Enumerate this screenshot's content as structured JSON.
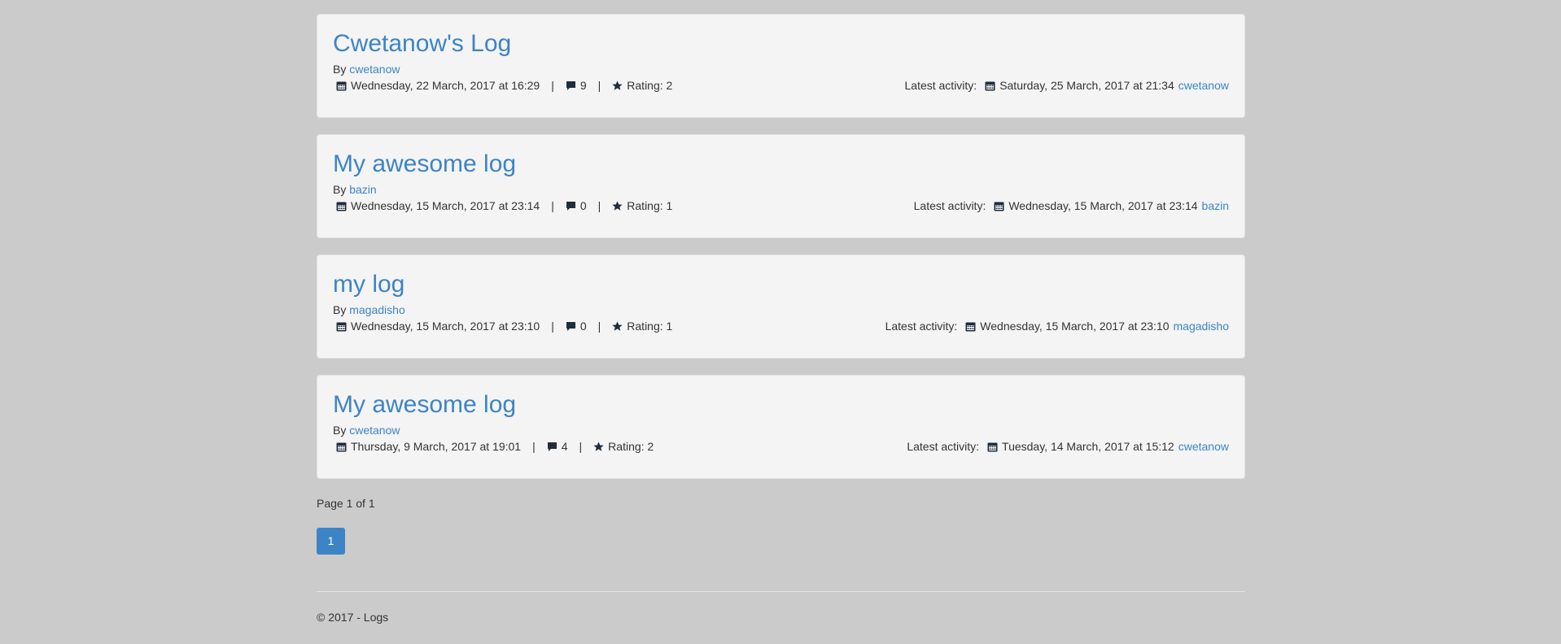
{
  "logs": [
    {
      "title": "Cwetanow's Log",
      "by_label": "By",
      "author": "cwetanow",
      "created": "Wednesday, 22 March, 2017 at 16:29",
      "comments": "9",
      "rating": "Rating: 2",
      "latest_label": "Latest activity:",
      "latest_date": "Saturday, 25 March, 2017 at 21:34",
      "latest_user": "cwetanow"
    },
    {
      "title": "My awesome log",
      "by_label": "By",
      "author": "bazin",
      "created": "Wednesday, 15 March, 2017 at 23:14",
      "comments": "0",
      "rating": "Rating: 1",
      "latest_label": "Latest activity:",
      "latest_date": "Wednesday, 15 March, 2017 at 23:14",
      "latest_user": "bazin"
    },
    {
      "title": "my log",
      "by_label": "By",
      "author": "magadisho",
      "created": "Wednesday, 15 March, 2017 at 23:10",
      "comments": "0",
      "rating": "Rating: 1",
      "latest_label": "Latest activity:",
      "latest_date": "Wednesday, 15 March, 2017 at 23:10",
      "latest_user": "magadisho"
    },
    {
      "title": "My awesome log",
      "by_label": "By",
      "author": "cwetanow",
      "created": "Thursday, 9 March, 2017 at 19:01",
      "comments": "4",
      "rating": "Rating: 2",
      "latest_label": "Latest activity:",
      "latest_date": "Tuesday, 14 March, 2017 at 15:12",
      "latest_user": "cwetanow"
    }
  ],
  "separator": "|",
  "pagination": {
    "info": "Page 1 of 1",
    "current_page": "1"
  },
  "footer": {
    "text": "© 2017 - Logs"
  },
  "colors": {
    "background": "#cbcbcb",
    "card": "#f4f4f4",
    "link": "#3d84c6",
    "text": "#333333"
  },
  "icons": {
    "date": "calendar-icon",
    "comments": "comment-icon",
    "rating": "star-icon"
  }
}
